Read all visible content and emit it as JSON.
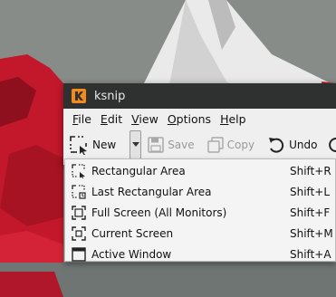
{
  "window": {
    "title": "ksnip"
  },
  "menubar": {
    "items": [
      {
        "label": "File",
        "mnemonic": "F",
        "rest": "ile"
      },
      {
        "label": "Edit",
        "mnemonic": "E",
        "rest": "dit"
      },
      {
        "label": "View",
        "mnemonic": "V",
        "rest": "iew"
      },
      {
        "label": "Options",
        "mnemonic": "O",
        "rest": "ptions"
      },
      {
        "label": "Help",
        "mnemonic": "H",
        "rest": "elp"
      }
    ]
  },
  "toolbar": {
    "new_label": "New",
    "save_label": "Save",
    "copy_label": "Copy",
    "undo_label": "Undo"
  },
  "capture_menu": {
    "items": [
      {
        "label": "Rectangular Area",
        "shortcut": "Shift+R",
        "icon": "rect-area-icon"
      },
      {
        "label": "Last Rectangular Area",
        "shortcut": "Shift+L",
        "icon": "last-rect-area-icon"
      },
      {
        "label": "Full Screen (All Monitors)",
        "shortcut": "Shift+F",
        "icon": "full-screen-icon"
      },
      {
        "label": "Current Screen",
        "shortcut": "Shift+M",
        "icon": "current-screen-icon"
      },
      {
        "label": "Active Window",
        "shortcut": "Shift+A",
        "icon": "active-window-icon"
      }
    ]
  },
  "colors": {
    "titlebar": "#2f3030",
    "window_bg": "#efefef",
    "menu_bg": "#f4f4f4",
    "brand_orange": "#f28a1c",
    "wallpaper_red": "#c81a2a"
  }
}
